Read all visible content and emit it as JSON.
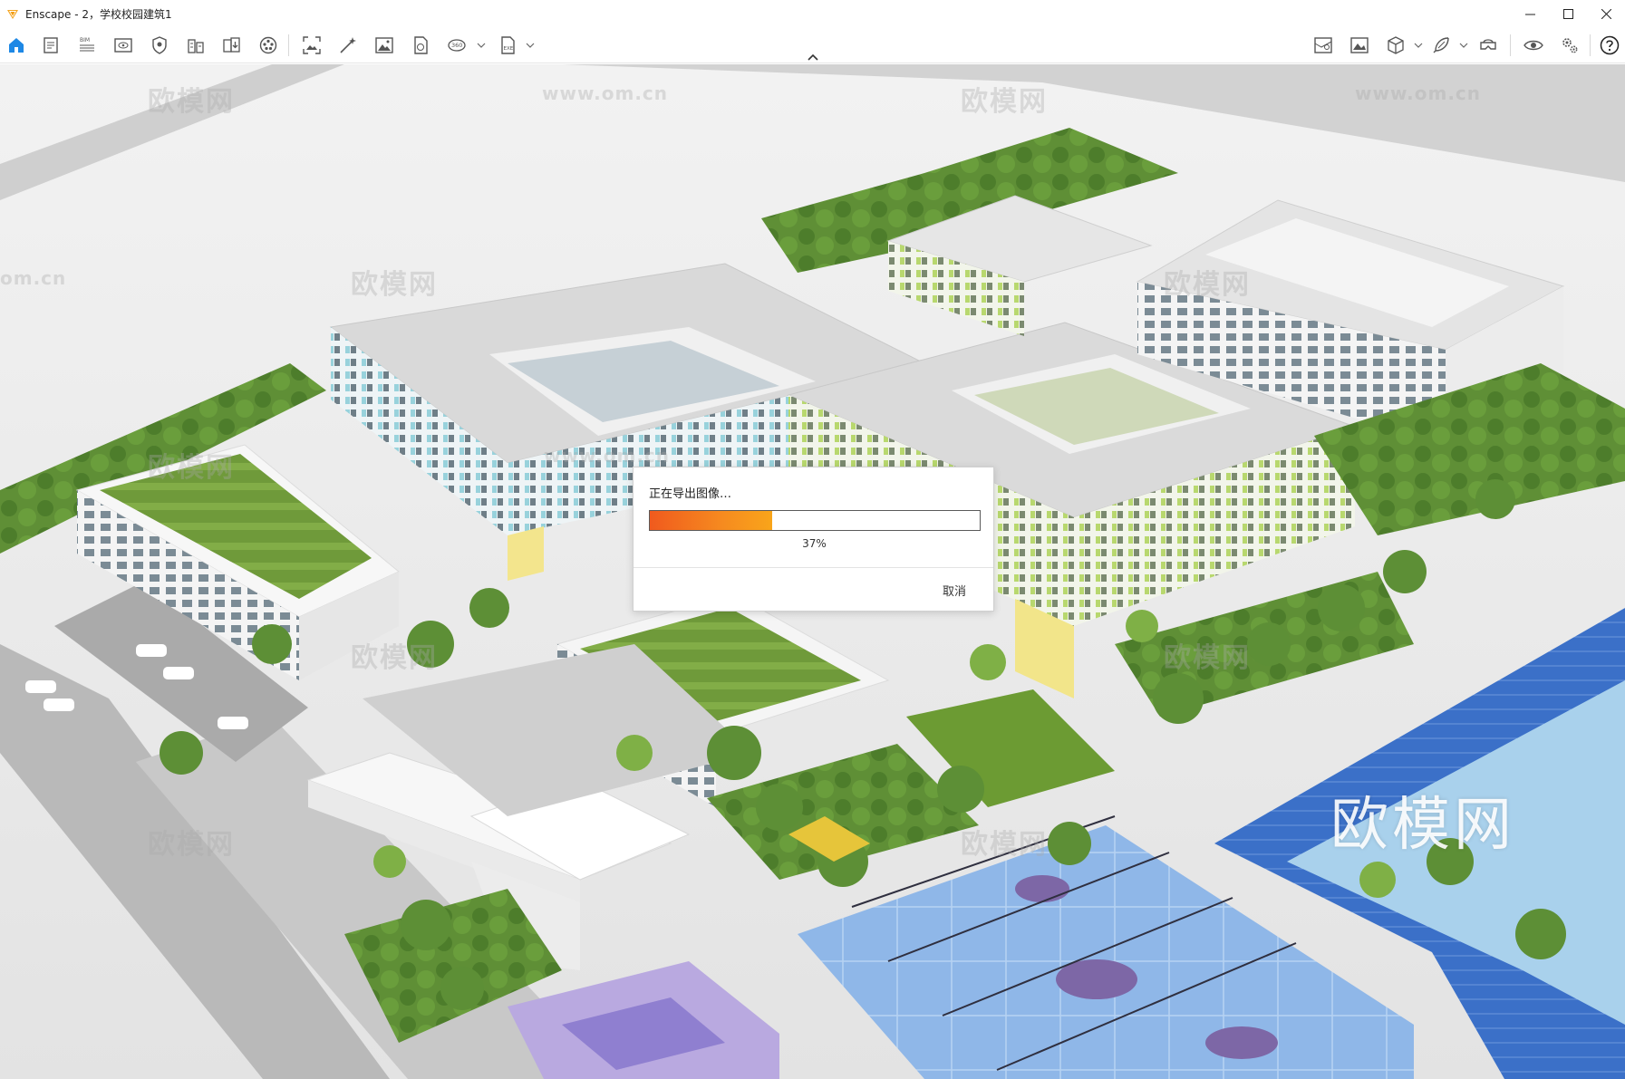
{
  "window": {
    "title": "Enscape - 2，学校校园建筑1",
    "controls": [
      "minimize",
      "maximize",
      "close"
    ]
  },
  "toolbar": {
    "left_icons": [
      "home-icon",
      "document-icon",
      "bim-icon",
      "visibility-icon",
      "shield-icon",
      "building-icon",
      "import-icon",
      "palette-icon",
      "screenshot-icon",
      "magic-wand-icon",
      "image-icon",
      "panorama-doc-icon",
      "panorama-360-icon",
      "exe-export-icon"
    ],
    "right_icons": [
      "map-icon",
      "landscape-icon",
      "cube-icon",
      "feather-icon",
      "vr-headset-icon",
      "eye-icon",
      "settings-icon",
      "help-icon"
    ],
    "bim_label": "BIM",
    "pano_label": "360",
    "exe_label": "EXE"
  },
  "viewport": {
    "watermarks": [
      "欧模网",
      "www.om.cn",
      "欧模网",
      "www.om.cn",
      "欧模网",
      "欧模网",
      "om.cn",
      "欧模网",
      "欧模网",
      "欧模网",
      "欧模网",
      "www.om.cn",
      "欧模网"
    ],
    "corner_watermark": "欧模网"
  },
  "dialog": {
    "title": "正在导出图像…",
    "progress": 0.37,
    "progress_text": "37%",
    "cancel_label": "取消"
  },
  "colors": {
    "accent": "#1e88e5",
    "progress_start": "#f05a1e",
    "progress_end": "#f9a51a"
  }
}
